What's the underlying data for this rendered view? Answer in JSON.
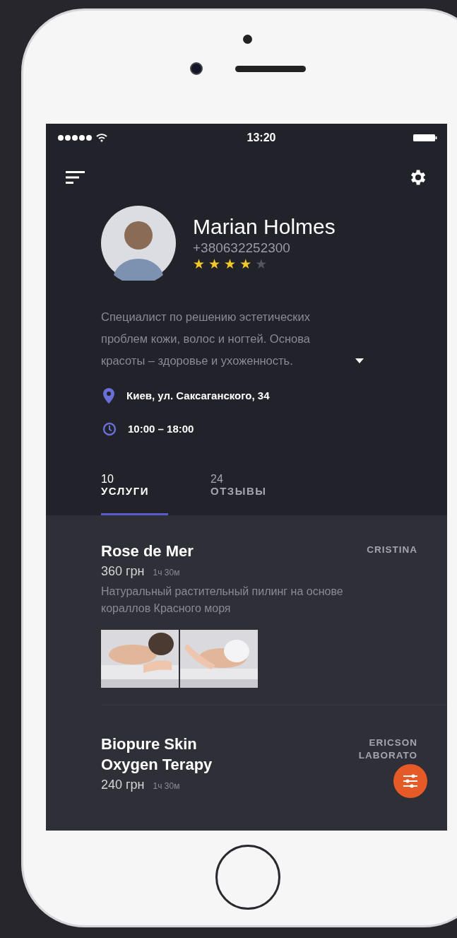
{
  "status_bar": {
    "time": "13:20"
  },
  "profile": {
    "name": "Marian Holmes",
    "phone": "+380632252300",
    "stars": 4
  },
  "description": "Специалист по решению эстетических проблем кожи, волос и ногтей. Основа красоты – здоровье и ухоженность.",
  "address": "Киев, ул. Саксаганского, 34",
  "hours": "10:00 – 18:00",
  "tabs": [
    {
      "count": "10",
      "label": "УСЛУГИ",
      "selected": true
    },
    {
      "count": "24",
      "label": "ОТЗЫВЫ",
      "selected": false
    }
  ],
  "services": [
    {
      "title": "Rose de Mer",
      "price": "360 грн",
      "duration": "1ч 30м",
      "author": "CRISTINA",
      "description": "Натуральный растительный пилинг на основе кораллов Красного моря"
    },
    {
      "title": "Biopure Skin Oxygen Terapy",
      "price": "240 грн",
      "duration": "1ч 30м",
      "author": "ERICSON LABORATO"
    }
  ]
}
